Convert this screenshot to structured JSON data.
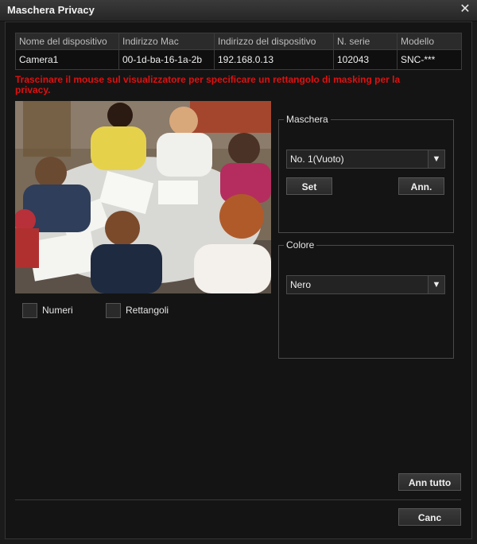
{
  "window": {
    "title": "Maschera Privacy",
    "close_icon": "✕"
  },
  "table": {
    "headers": [
      "Nome del dispositivo",
      "Indirizzo Mac",
      "Indirizzo del dispositivo",
      "N. serie",
      "Modello"
    ],
    "rows": [
      [
        "Camera1",
        "00-1d-ba-16-1a-2b",
        "192.168.0.13",
        "102043",
        "SNC-***"
      ]
    ]
  },
  "instruction": "Trascinare il mouse sul visualizzatore per specificare un rettangolo di masking per la privacy.",
  "options": {
    "numbers_label": "Numeri",
    "rectangles_label": "Rettangoli"
  },
  "mask_group": {
    "legend": "Maschera",
    "selected": "No. 1(Vuoto)",
    "set_label": "Set",
    "cancel_label": "Ann."
  },
  "color_group": {
    "legend": "Colore",
    "selected": "Nero"
  },
  "footer": {
    "cancel_all_label": "Ann tutto",
    "close_label": "Canc"
  },
  "colors": {
    "warning": "#e01010",
    "background": "#1b1b1b"
  }
}
